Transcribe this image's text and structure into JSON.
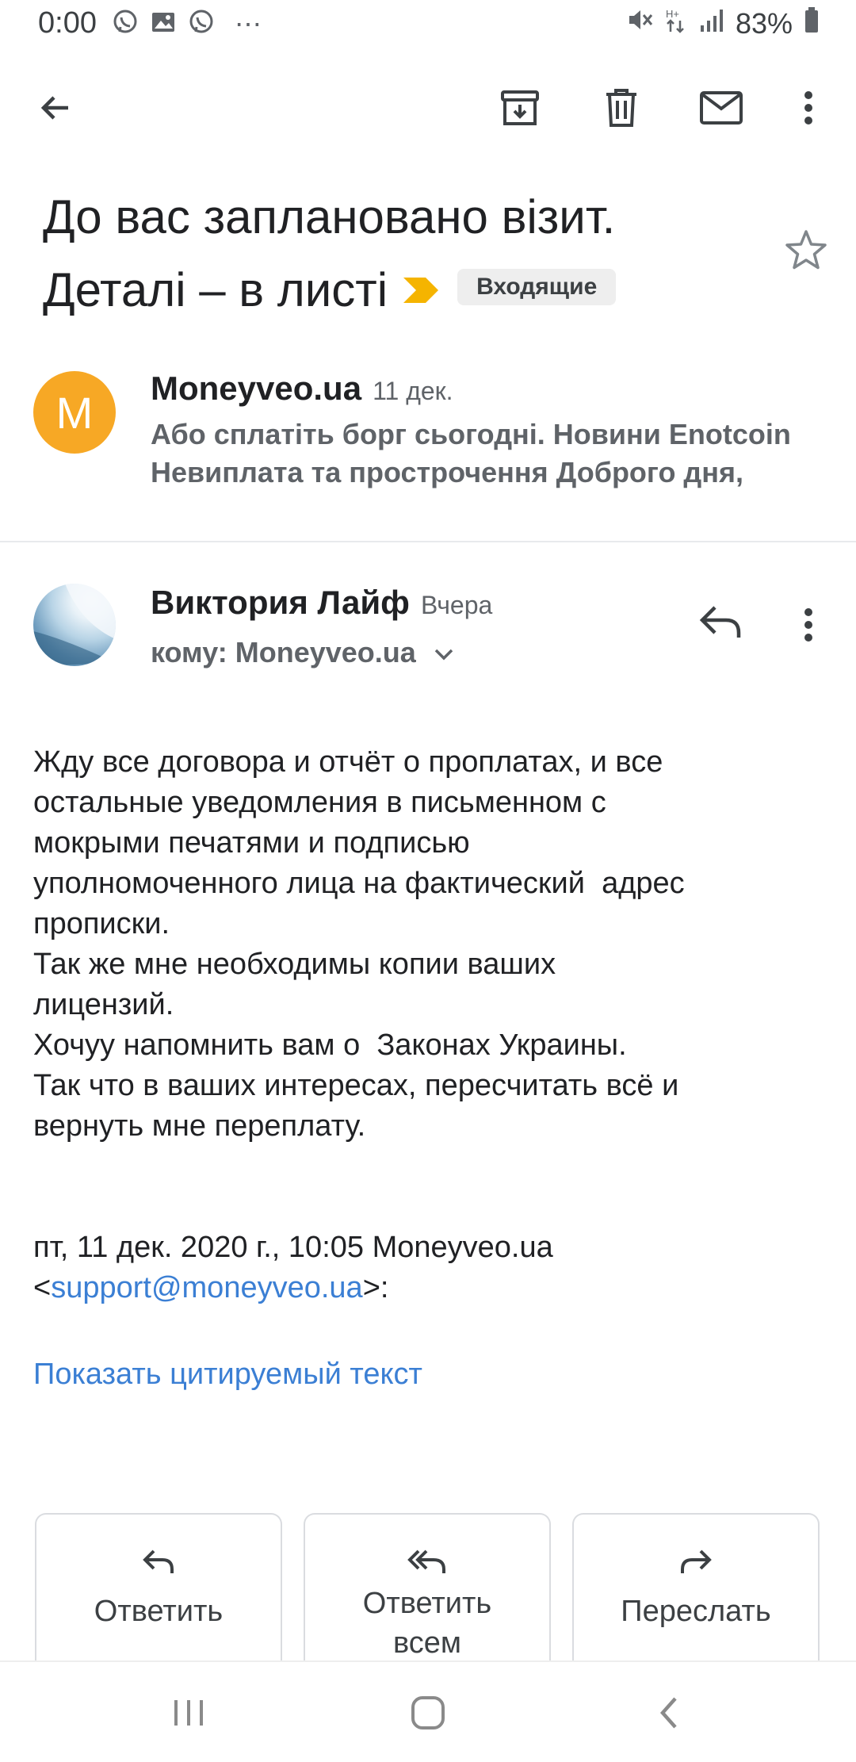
{
  "status_bar": {
    "time": "0:00",
    "battery": "83%"
  },
  "app_bar": {
    "icons": [
      "back-arrow-icon",
      "archive-icon",
      "delete-icon",
      "mail-icon",
      "more-vert-icon"
    ]
  },
  "subject": {
    "text": "До вас заплановано візит. Деталі – в листі",
    "label": "Входящие",
    "importance_color": "#f5b400"
  },
  "thread": {
    "collapsed_message": {
      "avatar_letter": "M",
      "avatar_color": "#f7a825",
      "sender": "Moneyveo.ua",
      "date": "11 дек.",
      "snippet_line1": "Або сплатіть борг сьогодні. Новини Enotcoin",
      "snippet_line2": "Невиплата та прострочення Доброго дня,"
    },
    "open_message": {
      "sender": "Виктория Лайф",
      "date": "Вчера",
      "recipient": "кому: Moneyveo.ua",
      "body_lines": [
        "Жду все договора и отчёт о проплатах, и все",
        "остальные уведомления в письменном с",
        "мокрыми печатями и подписью",
        "уполномоченного лица на фактический  адрес",
        "прописки.",
        "Так же мне необходимы копии ваших",
        "лицензий.",
        "Хочуу напомнить вам о  Законах Украины.",
        "Так что в ваших интересах, пересчитать всё и",
        "вернуть мне переплату."
      ],
      "quote_header": "пт, 11 дек. 2020 г., 10:05 Moneyveo.ua",
      "quote_lt": "<",
      "quote_email": "support@moneyveo.ua",
      "quote_gt": ">:",
      "show_quoted": "Показать цитируемый текст"
    }
  },
  "actions": {
    "reply": "Ответить",
    "reply_all_1": "Ответить",
    "reply_all_2": "всем",
    "forward": "Переслать"
  },
  "colors": {
    "link": "#3b7fd4",
    "label_bg": "#eeeeee",
    "divider": "#e8eaed"
  }
}
